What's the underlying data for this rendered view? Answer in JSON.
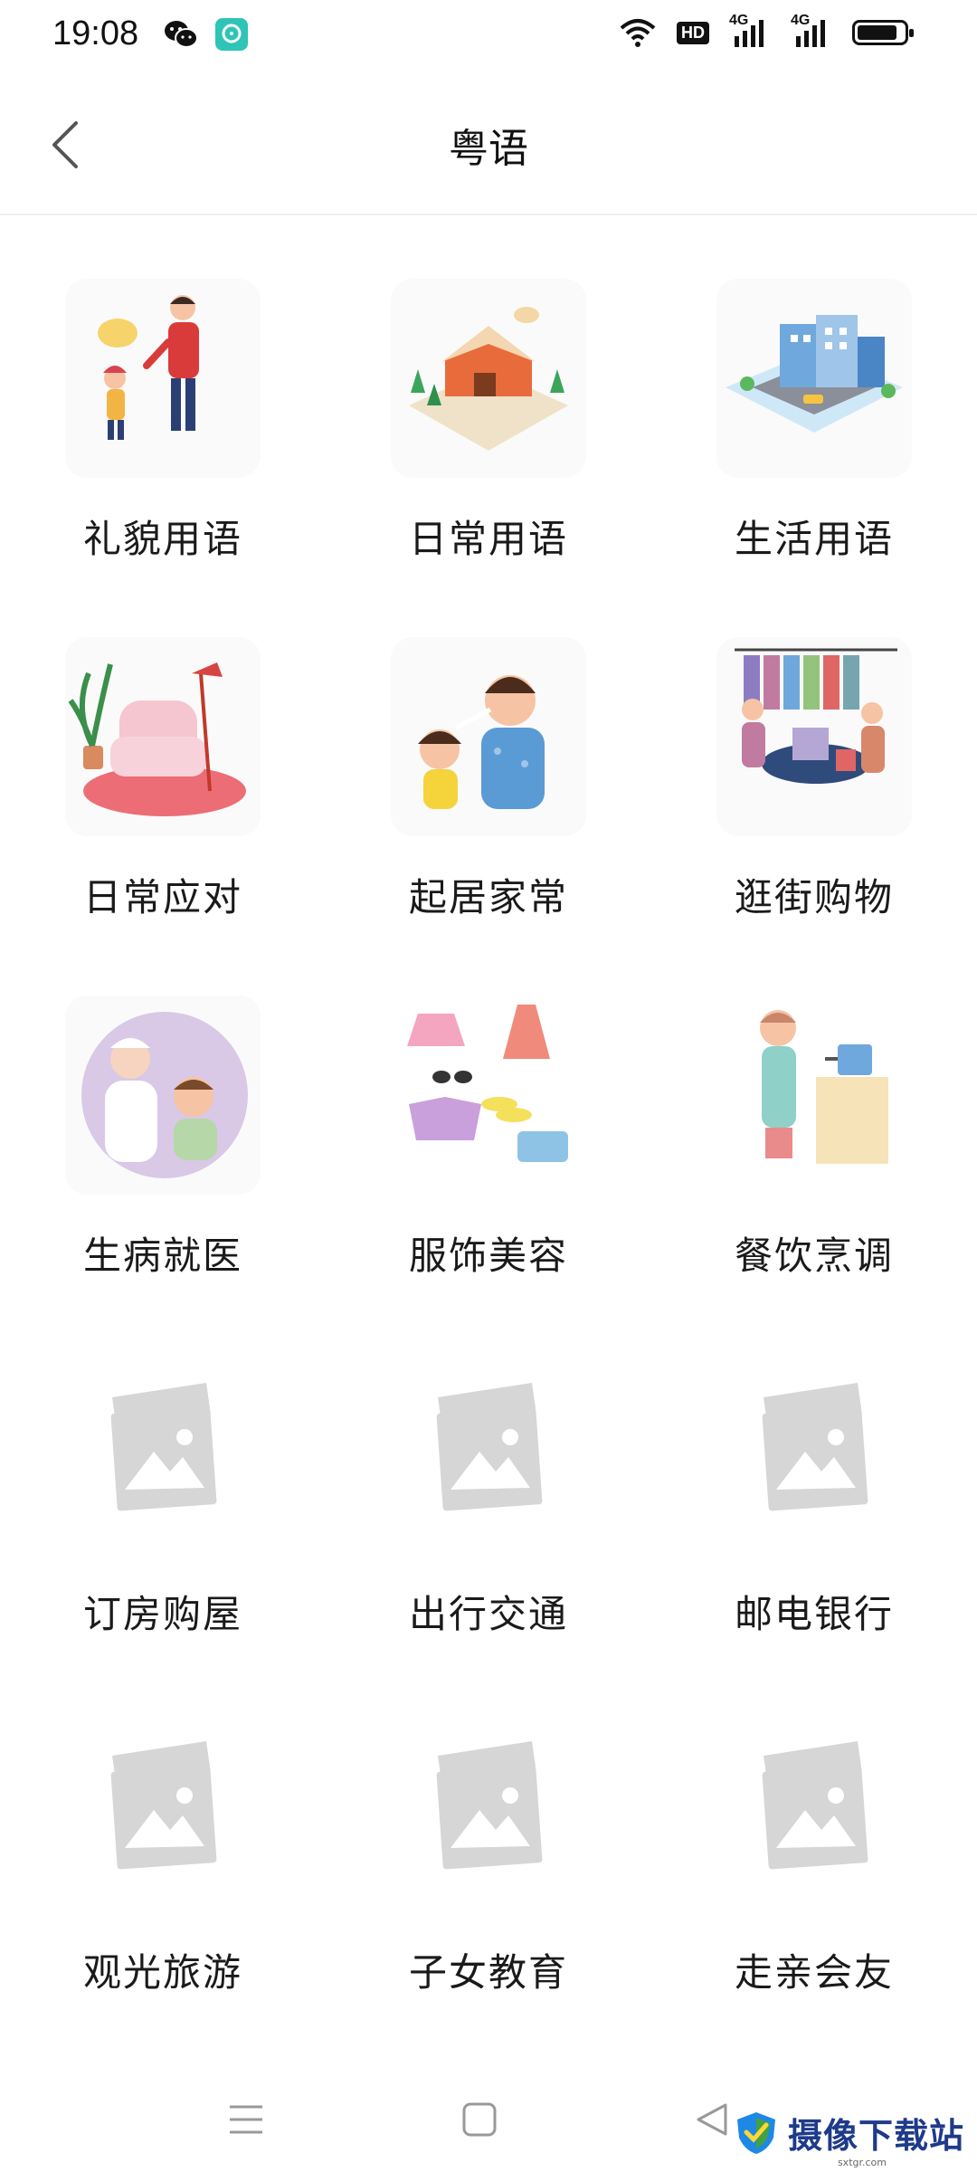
{
  "status_bar": {
    "time": "19:08",
    "left_icons": [
      "wechat-icon",
      "app-notification-icon"
    ],
    "right_icons": [
      "wifi-icon",
      "hd-icon",
      "signal-4g-icon",
      "signal-4g-icon",
      "battery-icon"
    ],
    "hd_label": "HD",
    "net_label_1": "4G",
    "net_label_2": "4G"
  },
  "header": {
    "back_icon": "chevron-left-icon",
    "title": "粤语"
  },
  "categories": [
    {
      "label": "礼貌用语",
      "image": "polite-phrases-illustration"
    },
    {
      "label": "日常用语",
      "image": "daily-phrases-illustration"
    },
    {
      "label": "生活用语",
      "image": "life-phrases-illustration"
    },
    {
      "label": "日常应对",
      "image": "daily-response-illustration"
    },
    {
      "label": "起居家常",
      "image": "home-life-illustration"
    },
    {
      "label": "逛街购物",
      "image": "shopping-illustration"
    },
    {
      "label": "生病就医",
      "image": "medical-illustration"
    },
    {
      "label": "服饰美容",
      "image": "clothing-illustration"
    },
    {
      "label": "餐饮烹调",
      "image": "cooking-illustration"
    },
    {
      "label": "订房购屋",
      "image": "image-placeholder-icon"
    },
    {
      "label": "出行交通",
      "image": "image-placeholder-icon"
    },
    {
      "label": "邮电银行",
      "image": "image-placeholder-icon"
    },
    {
      "label": "观光旅游",
      "image": "image-placeholder-icon"
    },
    {
      "label": "子女教育",
      "image": "image-placeholder-icon"
    },
    {
      "label": "走亲会友",
      "image": "image-placeholder-icon"
    }
  ],
  "nav_bar": {
    "icons": [
      "menu-icon",
      "home-square-icon",
      "back-triangle-icon"
    ]
  },
  "watermark": {
    "text": "摄像下载站",
    "sub": "sxtgr.com"
  },
  "colors": {
    "background": "#ffffff",
    "divider": "#eeeeee",
    "placeholder": "#d6d6d6",
    "text": "#1a1a1a"
  }
}
